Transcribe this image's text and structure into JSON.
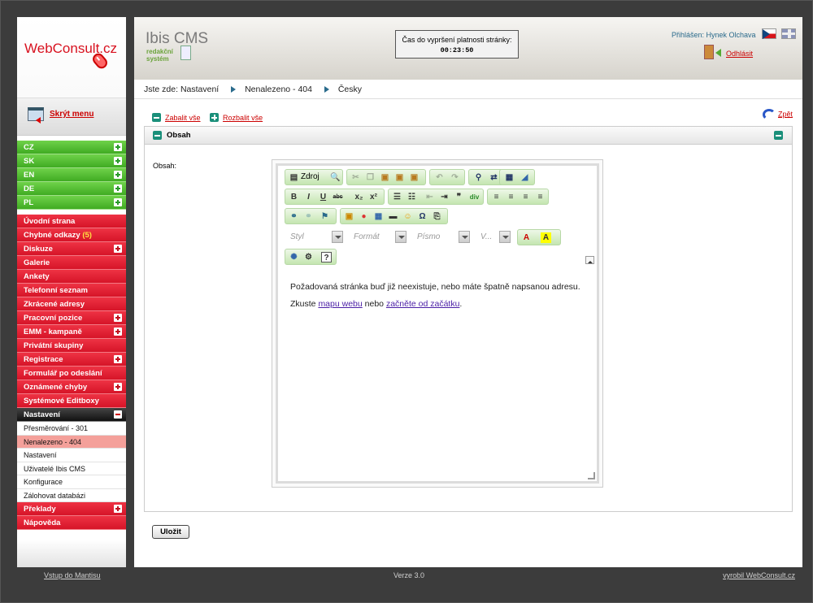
{
  "logo": {
    "text": "WebConsult.cz"
  },
  "sidebar": {
    "hide_menu": "Skrýt menu",
    "languages": [
      "CZ",
      "SK",
      "EN",
      "DE",
      "PL"
    ],
    "menu": [
      {
        "label": "Úvodní strana"
      },
      {
        "label": "Chybné odkazy",
        "badge": "(5)"
      },
      {
        "label": "Diskuze",
        "plus": true
      },
      {
        "label": "Galerie"
      },
      {
        "label": "Ankety"
      },
      {
        "label": "Telefonní seznam"
      },
      {
        "label": "Zkrácené adresy"
      },
      {
        "label": "Pracovní pozice",
        "plus": true
      },
      {
        "label": "EMM - kampaně",
        "plus": true
      },
      {
        "label": "Privátní skupiny"
      },
      {
        "label": "Registrace",
        "plus": true
      },
      {
        "label": "Formulář po odeslání"
      },
      {
        "label": "Oznámené chyby",
        "plus": true
      },
      {
        "label": "Systémové Editboxy"
      }
    ],
    "settings": {
      "label": "Nastavení",
      "items": [
        "Přesměrování - 301",
        "Nenalezeno - 404",
        "Nastavení",
        "Uživatelé Ibis CMS",
        "Konfigurace",
        "Zálohovat databázi"
      ],
      "active_index": 1
    },
    "after": [
      {
        "label": "Překlady",
        "plus": true
      },
      {
        "label": "Nápověda"
      }
    ]
  },
  "header": {
    "cms_name": "Ibis CMS",
    "cms_sub1": "redakční",
    "cms_sub2": "systém",
    "timer_label": "Čas do vypršení platnosti stránky:",
    "timer_value": "00:23:50",
    "user": "Přihlášen: Hynek Olchava",
    "logout": "Odhlásit"
  },
  "breadcrumb": {
    "prefix": "Jste zde:",
    "items": [
      "Nastavení",
      "Nenalezeno - 404",
      "Česky"
    ]
  },
  "tools": {
    "collapse_all": "Zabalit vše",
    "expand_all": "Rozbalit vše",
    "back": "Zpět"
  },
  "panel": {
    "title": "Obsah",
    "field_label": "Obsah:"
  },
  "editor": {
    "source": "Zdroj",
    "combos": [
      "Styl",
      "Formát",
      "Písmo",
      "V..."
    ],
    "line1": "Požadovaná stránka buď již neexistuje, nebo máte špatně napsanou adresu.",
    "line2_pre": "Zkuste ",
    "link1": "mapu webu",
    "line2_mid": " nebo ",
    "link2": "začněte od začátku",
    "line2_post": "."
  },
  "save_button": "Uložit",
  "footer": {
    "left": "Vstup do Mantisu",
    "center": "Verze 3.0",
    "right": "vyrobil WebConsult.cz"
  },
  "colors": {
    "green": "#3fab22",
    "red": "#d61428",
    "link": "#cc0000",
    "accent": "#1a8f7a"
  }
}
